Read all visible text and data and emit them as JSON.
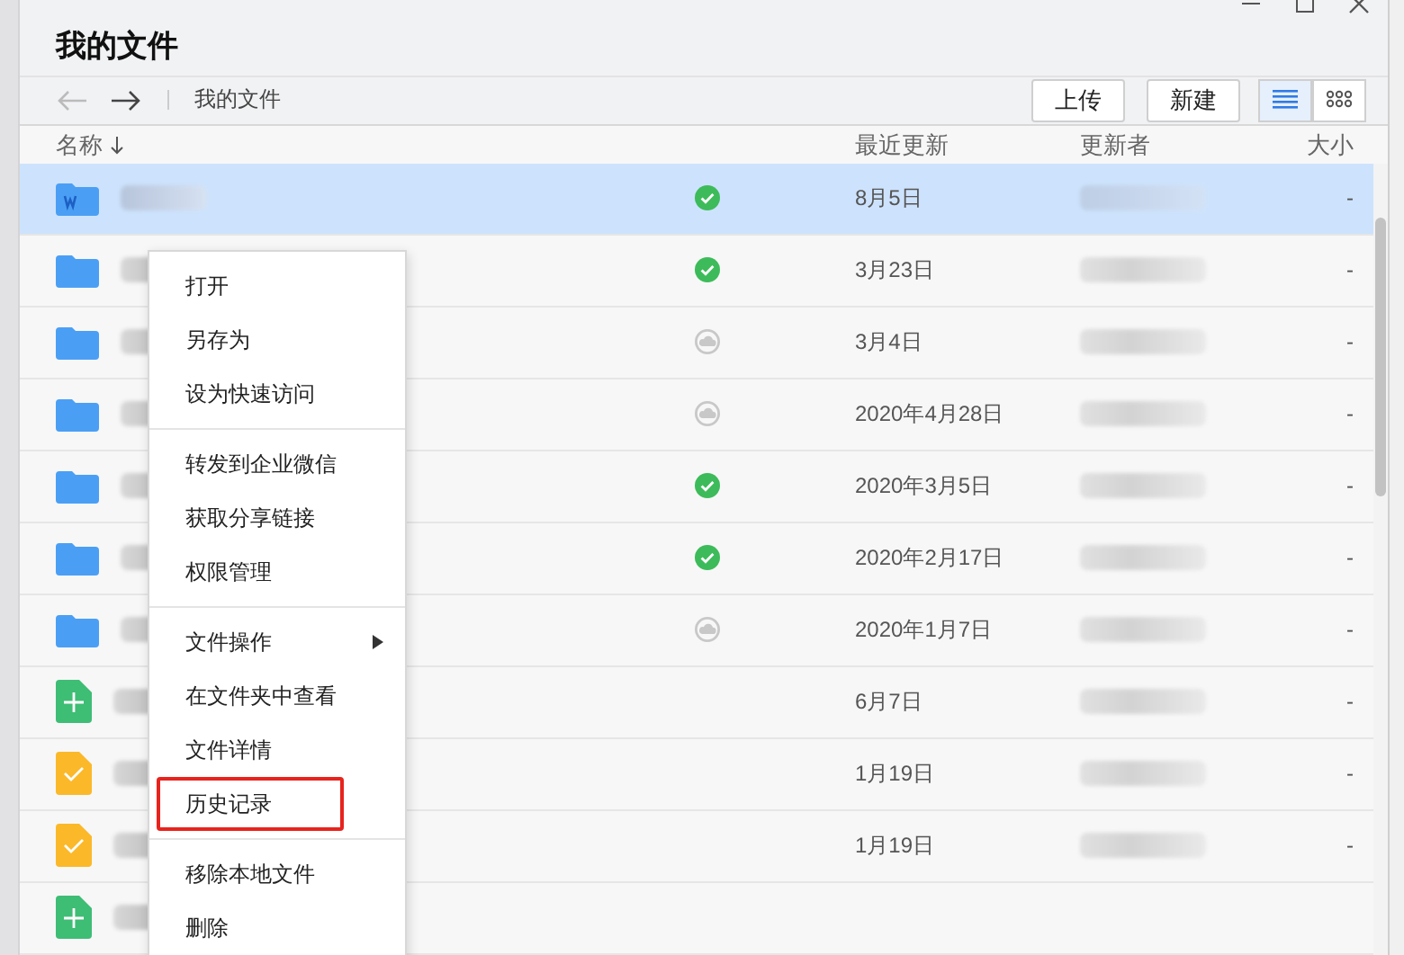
{
  "window": {
    "title": "我的文件"
  },
  "toolbar": {
    "breadcrumb": "我的文件",
    "back_enabled": false,
    "forward_enabled": true,
    "buttons": [
      "上传",
      "新建"
    ],
    "view_modes": [
      {
        "kind": "list",
        "selected": true
      },
      {
        "kind": "grid",
        "selected": false
      }
    ]
  },
  "table": {
    "columns": [
      "名称",
      "最近更新",
      "更新者",
      "大小"
    ],
    "rows": [
      {
        "kind": "docfolder",
        "synced": true,
        "cloud": false,
        "date": "8月5日",
        "size": "-",
        "selected": true
      },
      {
        "kind": "folder",
        "synced": true,
        "cloud": false,
        "date": "3月23日",
        "size": "-",
        "selected": false
      },
      {
        "kind": "folder",
        "synced": false,
        "cloud": true,
        "date": "3月4日",
        "size": "-",
        "selected": false
      },
      {
        "kind": "folder",
        "synced": false,
        "cloud": true,
        "date": "2020年4月28日",
        "size": "-",
        "selected": false
      },
      {
        "kind": "folder",
        "synced": true,
        "cloud": false,
        "date": "2020年3月5日",
        "size": "-",
        "selected": false
      },
      {
        "kind": "folder",
        "synced": true,
        "cloud": false,
        "date": "2020年2月17日",
        "size": "-",
        "selected": false
      },
      {
        "kind": "folder",
        "synced": false,
        "cloud": true,
        "date": "2020年1月7日",
        "size": "-",
        "selected": false
      },
      {
        "kind": "sheet",
        "synced": false,
        "cloud": false,
        "date": "6月7日",
        "size": "-",
        "selected": false
      },
      {
        "kind": "task",
        "synced": false,
        "cloud": false,
        "date": "1月19日",
        "size": "-",
        "selected": false
      },
      {
        "kind": "task",
        "synced": false,
        "cloud": false,
        "date": "1月19日",
        "size": "-",
        "selected": false
      },
      {
        "kind": "sheet",
        "synced": false,
        "cloud": false,
        "selected": false
      }
    ]
  },
  "context_menu": {
    "groups": [
      [
        {
          "label": "打开",
          "submenu": false,
          "highlighted": false
        },
        {
          "label": "另存为",
          "submenu": false,
          "highlighted": false
        },
        {
          "label": "设为快速访问",
          "submenu": false,
          "highlighted": false
        }
      ],
      [
        {
          "label": "转发到企业微信",
          "submenu": false,
          "highlighted": false
        },
        {
          "label": "获取分享链接",
          "submenu": false,
          "highlighted": false
        },
        {
          "label": "权限管理",
          "submenu": false,
          "highlighted": false
        }
      ],
      [
        {
          "label": "文件操作",
          "submenu": true,
          "highlighted": false
        },
        {
          "label": "在文件夹中查看",
          "submenu": false,
          "highlighted": false
        },
        {
          "label": "文件详情",
          "submenu": false,
          "highlighted": false
        },
        {
          "label": "历史记录",
          "submenu": false,
          "highlighted": true
        }
      ],
      [
        {
          "label": "移除本地文件",
          "submenu": false,
          "highlighted": false
        },
        {
          "label": "删除",
          "submenu": false,
          "highlighted": false
        }
      ]
    ]
  }
}
